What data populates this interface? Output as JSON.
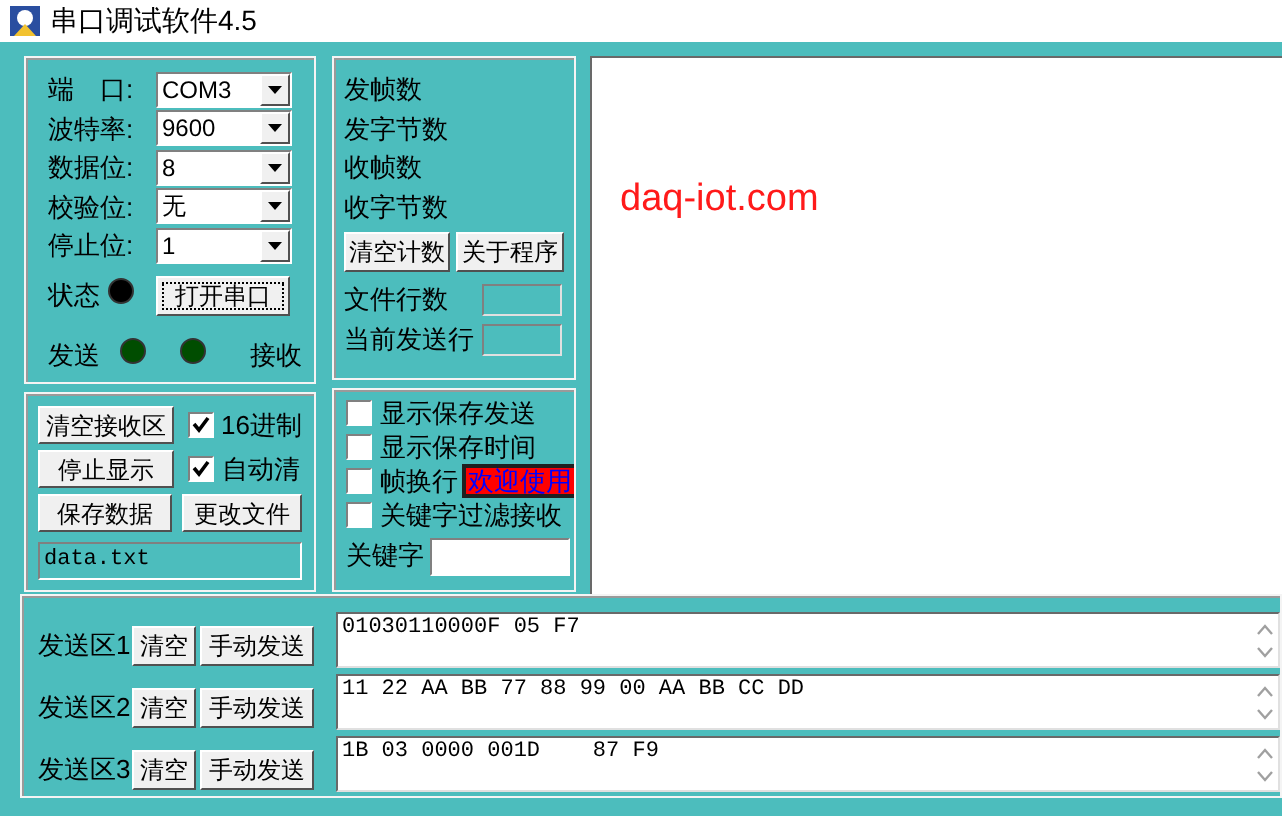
{
  "window": {
    "title": "串口调试软件4.5"
  },
  "port_settings": {
    "fields": [
      {
        "label": "端　口:",
        "value": "COM3"
      },
      {
        "label": "波特率:",
        "value": "9600"
      },
      {
        "label": "数据位:",
        "value": "8"
      },
      {
        "label": "校验位:",
        "value": "无"
      },
      {
        "label": "停止位:",
        "value": "1"
      }
    ],
    "status": {
      "label": "状态",
      "on": false
    },
    "open_button": "打开串口",
    "send_indicator": {
      "label": "发送",
      "on": false
    },
    "receive_indicator": {
      "label": "接收",
      "on": false
    }
  },
  "counters": {
    "labels": [
      "发帧数",
      "发字节数",
      "收帧数",
      "收字节数"
    ],
    "clear_button": "清空计数",
    "about_button": "关于程序",
    "file_lines": {
      "label": "文件行数"
    },
    "current_line": {
      "label": "当前发送行"
    }
  },
  "receive_area": {
    "text": "daq-iot.com"
  },
  "receive_controls": {
    "clear_button": "清空接收区",
    "stop_button": "停止显示",
    "save_button": "保存数据",
    "change_file_button": "更改文件",
    "options": [
      {
        "label": "16进制",
        "checked": true
      },
      {
        "label": "自动清",
        "checked": true
      }
    ],
    "file_name": "data.txt"
  },
  "display_options": {
    "options": [
      {
        "label": "显示保存发送",
        "checked": false
      },
      {
        "label": "显示保存时间",
        "checked": false
      },
      {
        "label": "帧换行",
        "checked": false
      },
      {
        "label": "关键字过滤接收",
        "checked": false
      }
    ],
    "welcome_badge": "欢迎使用",
    "keyword": {
      "label": "关键字"
    }
  },
  "send_areas": [
    {
      "label": "发送区1",
      "clear_button": "清空",
      "send_button": "手动发送",
      "value": "01030110000F 05 F7"
    },
    {
      "label": "发送区2",
      "clear_button": "清空",
      "send_button": "手动发送",
      "value": "11 22 AA BB 77 88 99 00 AA BB CC DD"
    },
    {
      "label": "发送区3",
      "clear_button": "清空",
      "send_button": "手动发送",
      "value": "1B 03 0000 001D    87 F9"
    }
  ]
}
